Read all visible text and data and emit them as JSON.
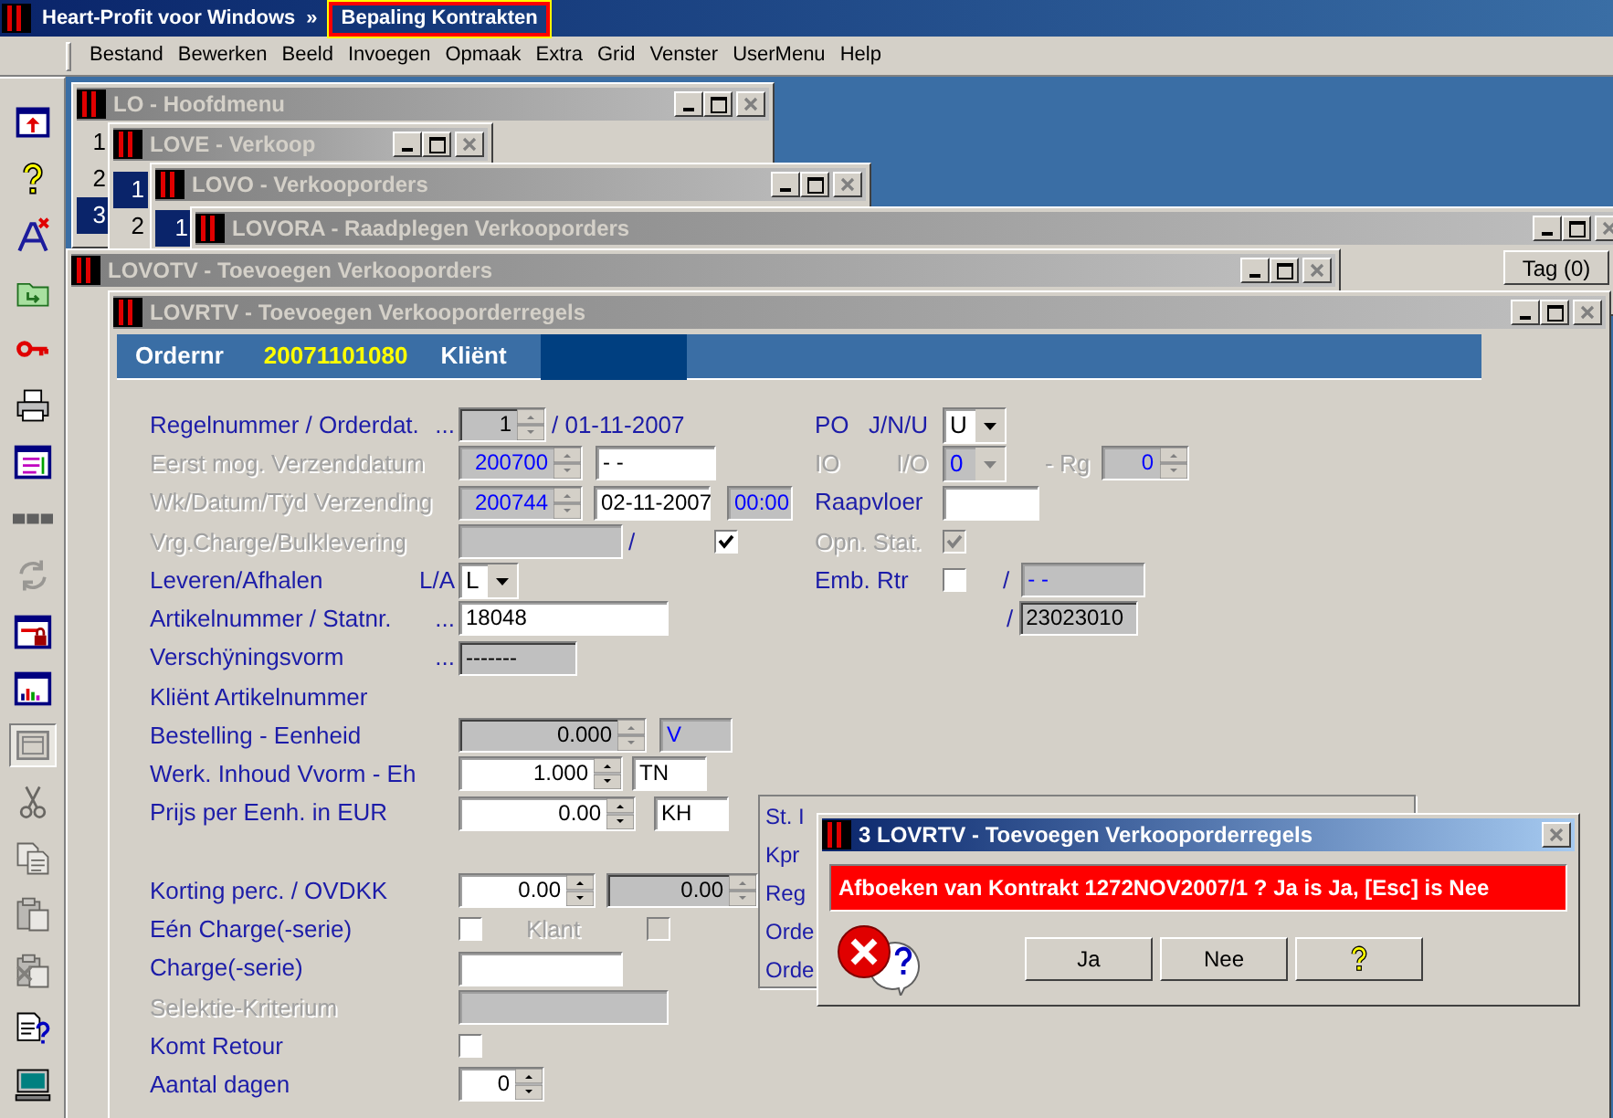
{
  "app_title_bar": {
    "title": "Heart-Profit voor Windows",
    "separator": "»",
    "context": "Bepaling Kontrakten",
    "highlighted": true
  },
  "menu": [
    "Bestand",
    "Bewerken",
    "Beeld",
    "Invoegen",
    "Opmaak",
    "Extra",
    "Grid",
    "Venster",
    "UserMenu",
    "Help"
  ],
  "toolbar": [
    {
      "kind": "export",
      "disabled": false,
      "pressed": false
    },
    {
      "kind": "help",
      "disabled": false,
      "pressed": false
    },
    {
      "kind": "font",
      "disabled": false,
      "pressed": false
    },
    {
      "kind": "folder",
      "disabled": false,
      "pressed": false
    },
    {
      "kind": "key",
      "disabled": false,
      "pressed": false
    },
    {
      "kind": "print",
      "disabled": false,
      "pressed": false
    },
    {
      "kind": "window",
      "disabled": false,
      "pressed": false
    },
    {
      "kind": "dots",
      "disabled": false,
      "pressed": false
    },
    {
      "kind": "refresh",
      "disabled": true,
      "pressed": false
    },
    {
      "kind": "lock",
      "disabled": false,
      "pressed": false
    },
    {
      "kind": "chart",
      "disabled": false,
      "pressed": false
    },
    {
      "kind": "frame",
      "disabled": false,
      "pressed": true
    },
    {
      "kind": "cut",
      "disabled": true,
      "pressed": false
    },
    {
      "kind": "copy",
      "disabled": true,
      "pressed": false
    },
    {
      "kind": "paste",
      "disabled": true,
      "pressed": false
    },
    {
      "kind": "paste_delete",
      "disabled": true,
      "pressed": false
    },
    {
      "kind": "doc_help",
      "disabled": false,
      "pressed": false
    },
    {
      "kind": "monitor",
      "disabled": false,
      "pressed": false
    }
  ],
  "windows": [
    {
      "title": "LO - Hoofdmenu",
      "items": [
        {
          "label": "1",
          "selected": false
        },
        {
          "label": "2",
          "selected": false
        },
        {
          "label": "3",
          "selected": true
        }
      ]
    },
    {
      "title": "LOVE - Verkoop",
      "items": [
        {
          "label": "1",
          "selected": true
        },
        {
          "label": "2",
          "selected": false
        }
      ]
    },
    {
      "title": "LOVO - Verkooporders",
      "items": [
        {
          "label": "1",
          "selected": true
        }
      ]
    },
    {
      "title": "LOVORA - Raadplegen Verkooporders",
      "buttons": [
        "Tag (0)"
      ]
    },
    {
      "title": "LOVOTV - Toevoegen Verkooporders"
    },
    {
      "title": "LOVRTV - Toevoegen Verkooporderregels"
    }
  ],
  "order_form": {
    "header": {
      "order_label": "Ordernr",
      "order_number": "20071101080",
      "client_label": "Kliënt"
    },
    "left_rows": [
      {
        "label": "Regelnummer / Orderdat.",
        "disabled": false,
        "suffix": "...",
        "fields": [
          {
            "kind": "spin",
            "value": "1",
            "readonly": true,
            "disabled": false
          },
          {
            "kind": "label",
            "value": "/ 01-11-2007",
            "disabled": false
          }
        ]
      },
      {
        "label": "Eerst mog. Verzenddatum",
        "disabled": true,
        "fields": [
          {
            "kind": "spin",
            "value": "200700",
            "readonly": false,
            "disabled": true
          },
          {
            "kind": "text",
            "value": "- -",
            "readonly": false,
            "disabled": false
          }
        ]
      },
      {
        "label": "Wk/Datum/Tÿd Verzending",
        "disabled": true,
        "fields": [
          {
            "kind": "spin",
            "value": "200744",
            "readonly": false,
            "disabled": true
          },
          {
            "kind": "text",
            "value": "02-11-2007",
            "readonly": false,
            "disabled": false
          },
          {
            "kind": "text",
            "value": "00:00",
            "readonly": false,
            "disabled": true
          }
        ]
      },
      {
        "label": "Vrg.Charge/Bulklevering",
        "disabled": true,
        "fields": [
          {
            "kind": "text",
            "readonly": false,
            "disabled": true
          },
          {
            "kind": "label",
            "value": "/",
            "disabled": false
          },
          {
            "kind": "check",
            "checked": true,
            "disabled": false
          }
        ]
      },
      {
        "label": "Leveren/Afhalen",
        "disabled": false,
        "suffix": "L/A",
        "fields": [
          {
            "kind": "select",
            "value": "L",
            "readonly": false,
            "disabled": false
          }
        ]
      },
      {
        "label": "Artikelnummer / Statnr.",
        "disabled": false,
        "suffix": "...",
        "fields": [
          {
            "kind": "text",
            "value": "18048",
            "readonly": false,
            "disabled": false
          }
        ]
      },
      {
        "label": "Verschÿningsvorm",
        "disabled": false,
        "suffix": "...",
        "fields": [
          {
            "kind": "text",
            "value": "-------",
            "readonly": true,
            "disabled": false
          }
        ]
      },
      {
        "label": "Kliënt Artikelnummer",
        "disabled": false,
        "fields": []
      },
      {
        "label": "Bestelling - Eenheid",
        "disabled": false,
        "fields": [
          {
            "kind": "spin",
            "value": "0.000",
            "readonly": true,
            "disabled": false
          },
          {
            "kind": "text",
            "value": "V",
            "readonly": false,
            "disabled": true
          }
        ]
      },
      {
        "label": "Werk. Inhoud Vvorm - Eh",
        "disabled": false,
        "fields": [
          {
            "kind": "spin",
            "value": "1.000",
            "readonly": false,
            "disabled": false
          },
          {
            "kind": "text",
            "value": "TN",
            "readonly": false,
            "disabled": false
          }
        ]
      },
      {
        "label": "Prijs per Eenh. in EUR",
        "disabled": false,
        "fields": [
          {
            "kind": "spin",
            "value": "0.00",
            "readonly": false,
            "disabled": false
          },
          {
            "kind": "text",
            "value": "KH",
            "readonly": false,
            "disabled": false
          }
        ]
      },
      {
        "label": "Korting perc. / OVDKK",
        "disabled": false,
        "fields": [
          {
            "kind": "spin",
            "value": "0.00",
            "readonly": false,
            "disabled": false
          },
          {
            "kind": "spin",
            "value": "0.00",
            "readonly": true,
            "disabled": false
          }
        ]
      },
      {
        "label": "Eén Charge(-serie)",
        "disabled": false,
        "fields": [
          {
            "kind": "check",
            "checked": false,
            "disabled": false
          },
          {
            "kind": "label",
            "value": "Klant",
            "disabled": true
          },
          {
            "kind": "check",
            "checked": false,
            "disabled": true
          }
        ]
      },
      {
        "label": "Charge(-serie)",
        "disabled": false,
        "fields": [
          {
            "kind": "text",
            "readonly": false,
            "disabled": false
          }
        ]
      },
      {
        "label": "Selektie-Kriterium",
        "disabled": true,
        "fields": [
          {
            "kind": "text",
            "readonly": false,
            "disabled": true
          }
        ]
      },
      {
        "label": "Komt Retour",
        "disabled": false,
        "fields": [
          {
            "kind": "check",
            "checked": false,
            "disabled": false
          }
        ]
      },
      {
        "label": "Aantal dagen",
        "disabled": false,
        "fields": [
          {
            "kind": "spin",
            "value": "0",
            "readonly": false,
            "disabled": false
          }
        ]
      }
    ],
    "right_rows": [
      {
        "label": "PO",
        "disabled": false,
        "suffix": "J/N/U",
        "fields": [
          {
            "kind": "select",
            "value": "U",
            "readonly": false,
            "disabled": false
          }
        ]
      },
      {
        "label": "IO",
        "disabled": true,
        "suffix": "I/O",
        "fields": [
          {
            "kind": "select",
            "value": "0",
            "readonly": false,
            "disabled": true
          },
          {
            "kind": "label",
            "value": "- Rg",
            "disabled": true
          },
          {
            "kind": "spin",
            "value": "0",
            "readonly": false,
            "disabled": true
          }
        ]
      },
      {
        "label": "Raapvloer",
        "disabled": false,
        "fields": [
          {
            "kind": "text",
            "readonly": false,
            "disabled": false
          }
        ]
      },
      {
        "label": "Opn. Stat.",
        "disabled": true,
        "fields": [
          {
            "kind": "check",
            "checked": true,
            "disabled": true
          }
        ]
      },
      {
        "label": "Emb. Rtr",
        "disabled": false,
        "fields": [
          {
            "kind": "check",
            "checked": false,
            "disabled": false
          },
          {
            "kind": "label",
            "value": "/",
            "disabled": false
          },
          {
            "kind": "text",
            "value": "- -",
            "readonly": false,
            "disabled": true
          }
        ]
      },
      {
        "fields": [
          {
            "kind": "label",
            "value": "/",
            "disabled": false
          },
          {
            "kind": "text",
            "value": "23023010",
            "readonly": true,
            "disabled": false
          }
        ]
      }
    ],
    "background_panel_labels": [
      "St. I",
      "Kpr",
      "Reg",
      "Orde",
      "Orde"
    ]
  },
  "dialog": {
    "title": "3 LOVRTV - Toevoegen Verkooporderregels",
    "message": "Afboeken van Kontrakt 1272NOV2007/1 ?  Ja is Ja, [Esc] is Nee",
    "buttons": [
      {
        "kind": "text",
        "label": "Ja"
      },
      {
        "kind": "text",
        "label": "Nee"
      },
      {
        "kind": "help"
      }
    ]
  }
}
